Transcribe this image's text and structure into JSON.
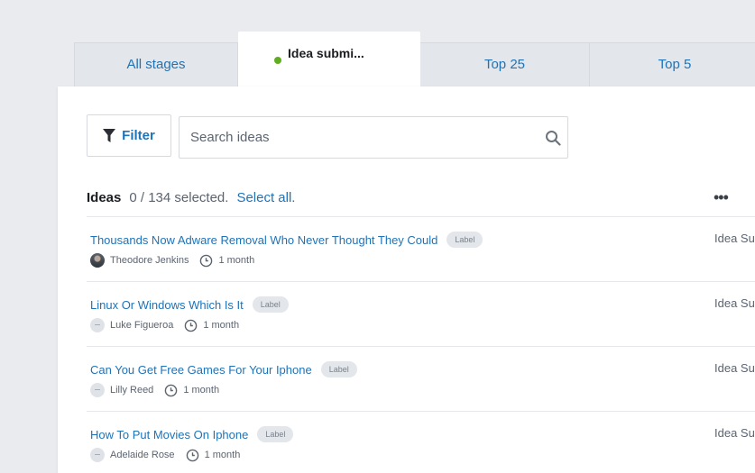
{
  "tabs": [
    {
      "label": "All stages",
      "active": false
    },
    {
      "label": "Idea submi...",
      "active": true,
      "status_color": "#5eae1f"
    },
    {
      "label": "Top 25",
      "active": false
    },
    {
      "label": "Top 5",
      "active": false
    }
  ],
  "toolbar": {
    "filter_label": "Filter",
    "search_placeholder": "Search ideas"
  },
  "ideas_header": {
    "title": "Ideas",
    "selection_count": "0 / 134 selected.",
    "select_all_label": "Select all.",
    "more_label": "•••"
  },
  "ideas": [
    {
      "title": "Thousands Now Adware Removal Who Never Thought They Could",
      "tag": "Label",
      "author": "Theodore Jenkins",
      "age": "1 month",
      "stage": "Idea Su",
      "avatar": "photo"
    },
    {
      "title": "Linux Or Windows Which Is It",
      "tag": "Label",
      "author": "Luke Figueroa",
      "age": "1 month",
      "stage": "Idea Su",
      "avatar": "blank"
    },
    {
      "title": "Can You Get Free Games For Your Iphone",
      "tag": "Label",
      "author": "Lilly Reed",
      "age": "1 month",
      "stage": "Idea Su",
      "avatar": "blank"
    },
    {
      "title": "How To Put Movies On Iphone",
      "tag": "Label",
      "author": "Adelaide Rose",
      "age": "1 month",
      "stage": "Idea Su",
      "avatar": "blank"
    }
  ],
  "colors": {
    "accent": "#1f73b7",
    "active_dot": "#5eae1f"
  }
}
